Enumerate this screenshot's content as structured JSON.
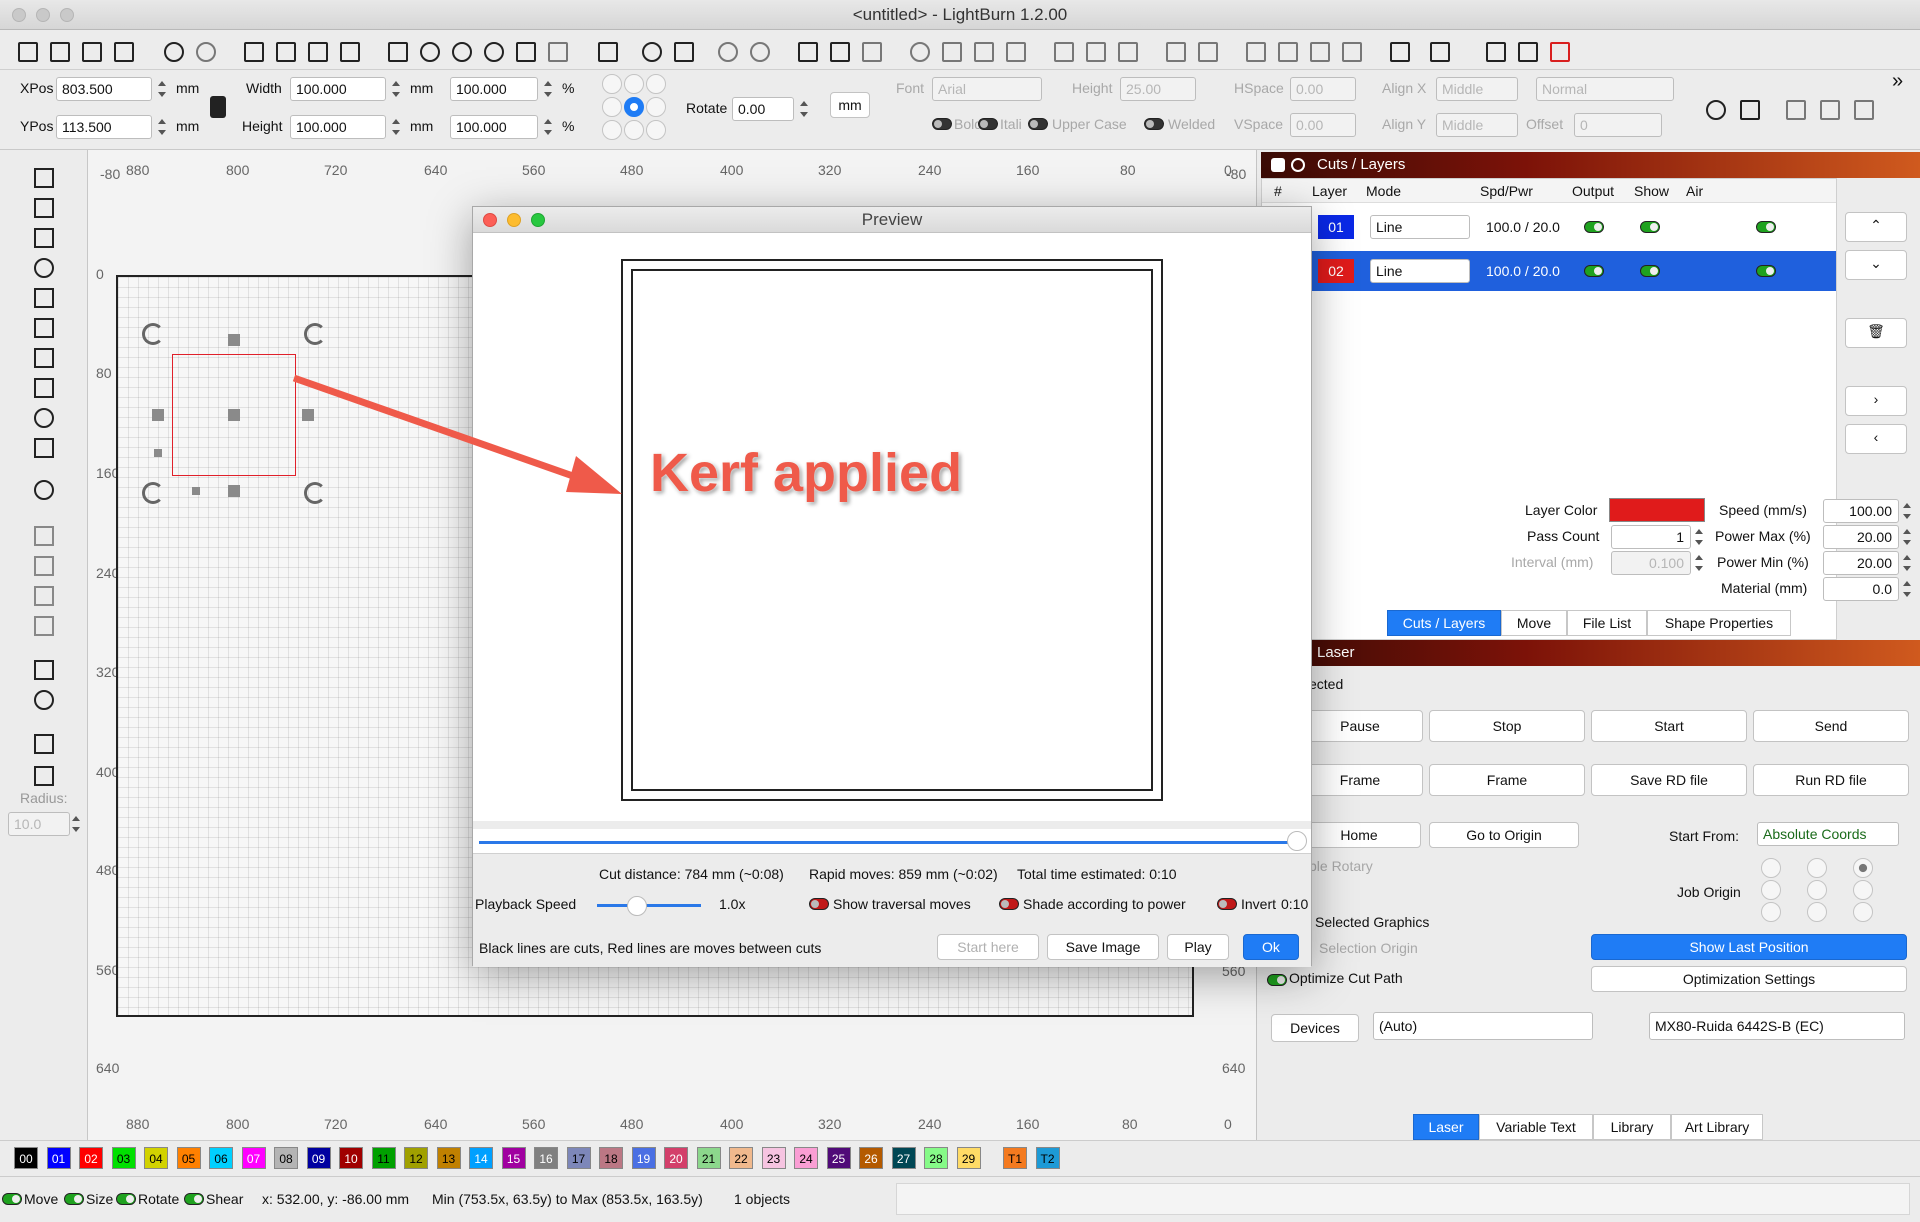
{
  "window": {
    "title": "<untitled> - LightBurn 1.2.00"
  },
  "props": {
    "xpos_label": "XPos",
    "xpos": "803.500",
    "ypos_label": "YPos",
    "ypos": "113.500",
    "mm": "mm",
    "width_label": "Width",
    "width": "100.000",
    "height_label": "Height",
    "height": "100.000",
    "pct_w": "100.000",
    "pct_h": "100.000",
    "pct": "%",
    "rotate_label": "Rotate",
    "rotate": "0.00",
    "unit_btn": "mm"
  },
  "font": {
    "font_label": "Font",
    "font": "Arial",
    "height_label": "Height",
    "height": "25.00",
    "hspace_label": "HSpace",
    "hspace": "0.00",
    "alignx_label": "Align X",
    "alignx": "Middle",
    "normal": "Normal",
    "bold": "Bold",
    "italic": "Itali",
    "upper": "Upper Case",
    "welded": "Welded",
    "vspace_label": "VSpace",
    "vspace": "0.00",
    "aligny_label": "Align Y",
    "aligny": "Middle",
    "offset_label": "Offset",
    "offset": "0"
  },
  "rulers": {
    "top": [
      "880",
      "800",
      "720",
      "640",
      "560",
      "480",
      "400",
      "320",
      "240",
      "160",
      "80",
      "0"
    ],
    "left": [
      "0",
      "80",
      "160",
      "240",
      "320",
      "400",
      "480",
      "560",
      "640"
    ],
    "corner_tl": "-80",
    "corner_tr": "-80"
  },
  "radius": {
    "label": "Radius:",
    "value": "10.0"
  },
  "preview": {
    "title": "Preview",
    "annotation": "Kerf applied",
    "cut_distance": "Cut distance: 784 mm (~0:08)",
    "rapid": "Rapid moves: 859 mm (~0:02)",
    "total": "Total time estimated: 0:10",
    "playback_label": "Playback Speed",
    "playback_value": "1.0x",
    "show_traversal": "Show traversal moves",
    "shade": "Shade according to power",
    "invert": "Invert",
    "time": "0:10",
    "legend": "Black lines are cuts, Red lines are moves between cuts",
    "start_here": "Start here",
    "save_image": "Save Image",
    "play": "Play",
    "ok": "Ok"
  },
  "cuts": {
    "panel_title": "Cuts / Layers",
    "headers": [
      "#",
      "Layer",
      "Mode",
      "Spd/Pwr",
      "Output",
      "Show",
      "Air"
    ],
    "rows": [
      {
        "layer": "01",
        "mode": "Line",
        "spdpwr": "100.0 / 20.0",
        "color": "#0a28e6"
      },
      {
        "layer": "02",
        "mode": "Line",
        "spdpwr": "100.0 / 20.0",
        "color": "#e01b1b"
      }
    ],
    "layer_color_label": "Layer Color",
    "pass_count_label": "Pass Count",
    "pass_count": "1",
    "interval_label": "Interval (mm)",
    "interval": "0.100",
    "speed_label": "Speed (mm/s)",
    "speed": "100.00",
    "pmax_label": "Power Max (%)",
    "pmax": "20.00",
    "pmin_label": "Power Min (%)",
    "pmin": "20.00",
    "material_label": "Material (mm)",
    "material": "0.0"
  },
  "tabs1": [
    "Cuts / Layers",
    "Move",
    "File List",
    "Shape Properties"
  ],
  "laser": {
    "panel_title": "Laser",
    "status": "ected",
    "pause": "Pause",
    "stop": "Stop",
    "start": "Start",
    "send": "Send",
    "frame1": "Frame",
    "frame2": "Frame",
    "save_rd": "Save RD file",
    "run_rd": "Run RD file",
    "home": "Home",
    "go_origin": "Go to Origin",
    "start_from_label": "Start From:",
    "start_from": "Absolute Coords",
    "rotary": "ble Rotary",
    "job_origin": "Job Origin",
    "selected_graphics": "Selected Graphics",
    "selection_origin": "Selection Origin",
    "show_last": "Show Last Position",
    "optimize": "Optimize Cut Path",
    "opt_settings": "Optimization Settings",
    "devices": "Devices",
    "auto": "(Auto)",
    "device": "MX80-Ruida 6442S-B (EC)"
  },
  "tabs2": [
    "Laser",
    "Variable Text",
    "Library",
    "Art Library"
  ],
  "palette": [
    {
      "l": "00",
      "c": "#000000",
      "t": "#ffffff"
    },
    {
      "l": "01",
      "c": "#0000ff",
      "t": "#ffffff"
    },
    {
      "l": "02",
      "c": "#ff0000",
      "t": "#ffffff"
    },
    {
      "l": "03",
      "c": "#00e000",
      "t": "#000000"
    },
    {
      "l": "04",
      "c": "#d2d200",
      "t": "#000000"
    },
    {
      "l": "05",
      "c": "#ff8000",
      "t": "#000000"
    },
    {
      "l": "06",
      "c": "#00d0ff",
      "t": "#000000"
    },
    {
      "l": "07",
      "c": "#ff00ff",
      "t": "#ffffff"
    },
    {
      "l": "08",
      "c": "#b4b4b4",
      "t": "#000000"
    },
    {
      "l": "09",
      "c": "#0000a0",
      "t": "#ffffff"
    },
    {
      "l": "10",
      "c": "#a00000",
      "t": "#ffffff"
    },
    {
      "l": "11",
      "c": "#00a000",
      "t": "#000000"
    },
    {
      "l": "12",
      "c": "#a0a000",
      "t": "#000000"
    },
    {
      "l": "13",
      "c": "#c08000",
      "t": "#000000"
    },
    {
      "l": "14",
      "c": "#00a0ff",
      "t": "#ffffff"
    },
    {
      "l": "15",
      "c": "#a000a0",
      "t": "#ffffff"
    },
    {
      "l": "16",
      "c": "#808080",
      "t": "#ffffff"
    },
    {
      "l": "17",
      "c": "#7d87b9",
      "t": "#000000"
    },
    {
      "l": "18",
      "c": "#bb7784",
      "t": "#000000"
    },
    {
      "l": "19",
      "c": "#4a6fe3",
      "t": "#ffffff"
    },
    {
      "l": "20",
      "c": "#d33f6a",
      "t": "#ffffff"
    },
    {
      "l": "21",
      "c": "#8cd78c",
      "t": "#000000"
    },
    {
      "l": "22",
      "c": "#f0b98d",
      "t": "#000000"
    },
    {
      "l": "23",
      "c": "#f6c4e1",
      "t": "#000000"
    },
    {
      "l": "24",
      "c": "#fa9ed4",
      "t": "#000000"
    },
    {
      "l": "25",
      "c": "#500a78",
      "t": "#ffffff"
    },
    {
      "l": "26",
      "c": "#b45a00",
      "t": "#ffffff"
    },
    {
      "l": "27",
      "c": "#004754",
      "t": "#ffffff"
    },
    {
      "l": "28",
      "c": "#86fa88",
      "t": "#000000"
    },
    {
      "l": "29",
      "c": "#ffdb66",
      "t": "#000000"
    },
    {
      "l": "T1",
      "c": "#f47a1f",
      "t": "#000000"
    },
    {
      "l": "T2",
      "c": "#1d9ad6",
      "t": "#000000"
    }
  ],
  "status": {
    "move": "Move",
    "size": "Size",
    "rotate": "Rotate",
    "shear": "Shear",
    "coords": "x: 532.00, y: -86.00 mm",
    "minmax": "Min (753.5x, 63.5y) to Max (853.5x, 163.5y)",
    "objects": "1 objects"
  }
}
